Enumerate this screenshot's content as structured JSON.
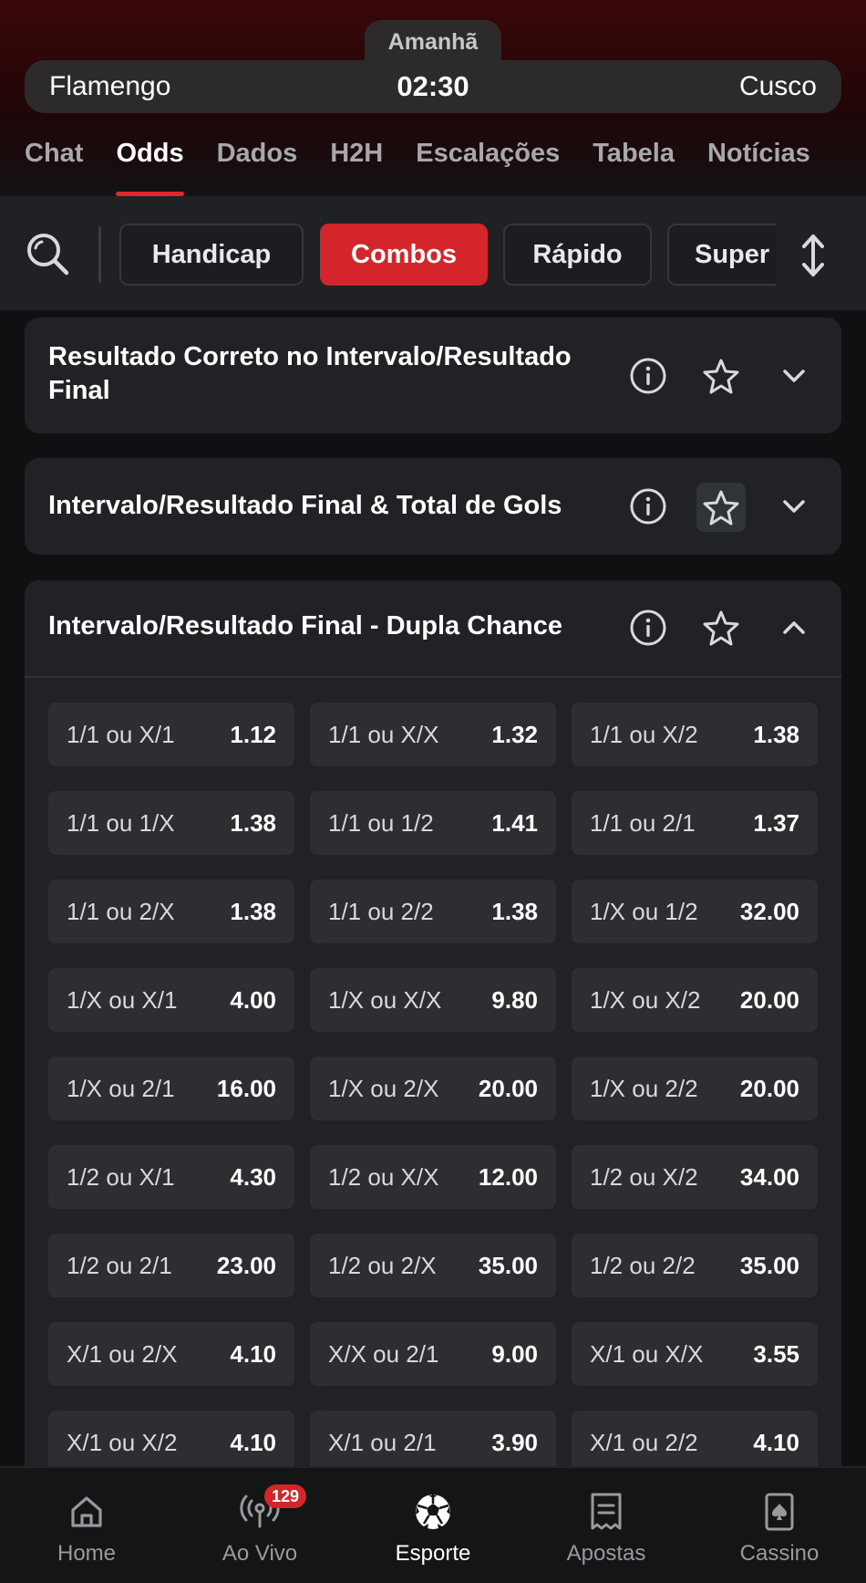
{
  "header": {
    "date": "Amanhã",
    "home_team": "Flamengo",
    "time": "02:30",
    "away_team": "Cusco"
  },
  "tabs": [
    {
      "label": "Chat"
    },
    {
      "label": "Odds"
    },
    {
      "label": "Dados"
    },
    {
      "label": "H2H"
    },
    {
      "label": "Escalações"
    },
    {
      "label": "Tabela"
    },
    {
      "label": "Notícias"
    }
  ],
  "filters": [
    {
      "label": "Handicap"
    },
    {
      "label": "Combos"
    },
    {
      "label": "Rápido"
    },
    {
      "label": "Super"
    }
  ],
  "markets": [
    {
      "title_line1": "Resultado Correto no Intervalo/Resultado",
      "title_line2": "Final"
    },
    {
      "title": "Intervalo/Resultado Final & Total de Gols"
    },
    {
      "title": "Intervalo/Resultado Final - Dupla Chance"
    }
  ],
  "odds": [
    {
      "label": "1/1 ou X/1",
      "value": "1.12"
    },
    {
      "label": "1/1 ou X/X",
      "value": "1.32"
    },
    {
      "label": "1/1 ou X/2",
      "value": "1.38"
    },
    {
      "label": "1/1 ou 1/X",
      "value": "1.38"
    },
    {
      "label": "1/1 ou 1/2",
      "value": "1.41"
    },
    {
      "label": "1/1 ou 2/1",
      "value": "1.37"
    },
    {
      "label": "1/1 ou 2/X",
      "value": "1.38"
    },
    {
      "label": "1/1 ou 2/2",
      "value": "1.38"
    },
    {
      "label": "1/X ou 1/2",
      "value": "32.00"
    },
    {
      "label": "1/X ou X/1",
      "value": "4.00"
    },
    {
      "label": "1/X ou X/X",
      "value": "9.80"
    },
    {
      "label": "1/X ou X/2",
      "value": "20.00"
    },
    {
      "label": "1/X ou 2/1",
      "value": "16.00"
    },
    {
      "label": "1/X ou 2/X",
      "value": "20.00"
    },
    {
      "label": "1/X ou 2/2",
      "value": "20.00"
    },
    {
      "label": "1/2 ou X/1",
      "value": "4.30"
    },
    {
      "label": "1/2 ou X/X",
      "value": "12.00"
    },
    {
      "label": "1/2 ou X/2",
      "value": "34.00"
    },
    {
      "label": "1/2 ou 2/1",
      "value": "23.00"
    },
    {
      "label": "1/2 ou 2/X",
      "value": "35.00"
    },
    {
      "label": "1/2 ou 2/2",
      "value": "35.00"
    },
    {
      "label": "X/1 ou 2/X",
      "value": "4.10"
    },
    {
      "label": "X/X ou 2/1",
      "value": "9.00"
    },
    {
      "label": "X/1 ou X/X",
      "value": "3.55"
    },
    {
      "label": "X/1 ou X/2",
      "value": "4.10"
    },
    {
      "label": "X/1 ou 2/1",
      "value": "3.90"
    },
    {
      "label": "X/1 ou 2/2",
      "value": "4.10"
    }
  ],
  "nav": [
    {
      "label": "Home",
      "icon": "home-icon"
    },
    {
      "label": "Ao Vivo",
      "icon": "live-broadcast-icon",
      "badge": "129"
    },
    {
      "label": "Esporte",
      "icon": "soccer-ball-icon"
    },
    {
      "label": "Apostas",
      "icon": "bet-slip-icon"
    },
    {
      "label": "Cassino",
      "icon": "playing-card-icon"
    }
  ],
  "colors": {
    "accent": "#d4252a",
    "background": "#0f1012",
    "card": "#202225",
    "odd_button": "#2c2e32"
  }
}
